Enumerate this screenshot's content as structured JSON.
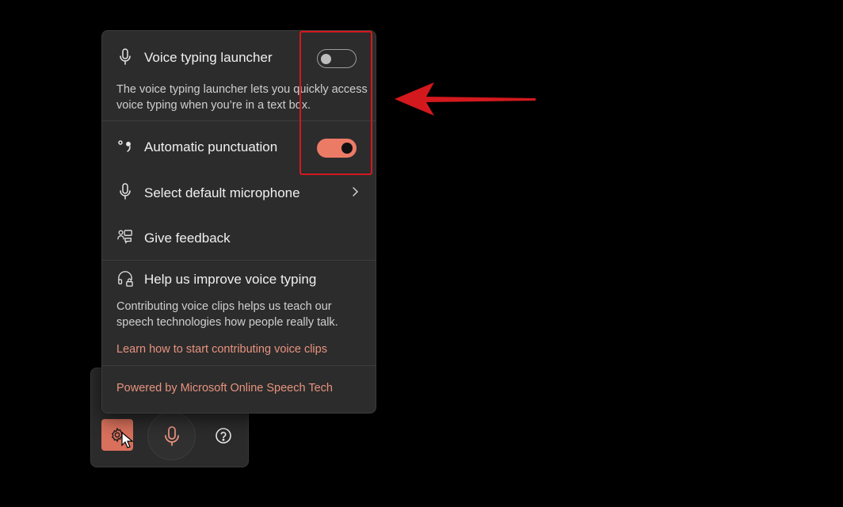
{
  "panel": {
    "voice_launcher": {
      "title": "Voice typing launcher",
      "description": "The voice typing launcher lets you quickly access voice typing when you’re in a text box.",
      "toggle_state": "off",
      "icon": "microphone-icon"
    },
    "auto_punctuation": {
      "title": "Automatic punctuation",
      "toggle_state": "on",
      "icon": "punctuation-icon"
    },
    "select_microphone": {
      "title": "Select default microphone",
      "icon": "microphone-icon"
    },
    "give_feedback": {
      "title": "Give feedback",
      "icon": "feedback-icon"
    },
    "improve": {
      "title": "Help us improve voice typing",
      "description": "Contributing voice clips helps us teach our speech technologies how people really talk.",
      "link": "Learn how to start contributing voice clips",
      "icon": "headset-lock-icon"
    },
    "powered_by": "Powered by Microsoft Online Speech Tech"
  },
  "toolbar": {
    "settings_icon": "gear-icon",
    "mic_icon": "microphone-icon",
    "help_icon": "question-circle-icon"
  },
  "colors": {
    "accent": "#ec7b66",
    "link": "#e8937f",
    "annotation": "#d3191e",
    "panel_bg": "#2c2c2c"
  }
}
